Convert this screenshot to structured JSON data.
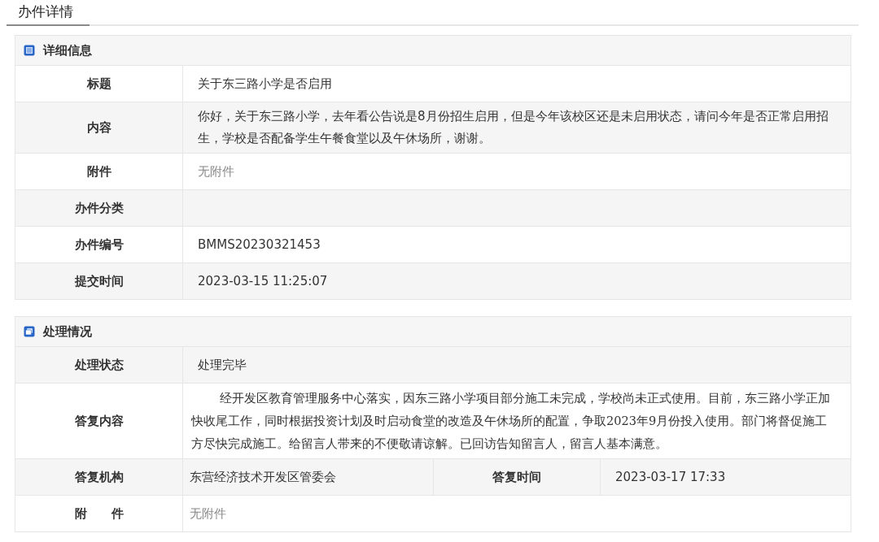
{
  "page_tab": {
    "label": "办件详情",
    "selected": true
  },
  "sections": [
    {
      "kind": "info",
      "title": "详细信息",
      "rows": [
        {
          "cells": [
            {
              "kind": "label",
              "text": "标题"
            },
            {
              "kind": "value",
              "text": "关于东三路小学是否启用"
            }
          ]
        },
        {
          "cells": [
            {
              "kind": "label",
              "text": "内容"
            },
            {
              "kind": "value",
              "text": "你好，关于东三路小学，去年看公告说是8月份招生启用，但是今年该校区还是未启用状态，请问今年是否正常启用招生，学校是否配备学生午餐食堂以及午休场所，谢谢。"
            }
          ]
        },
        {
          "cells": [
            {
              "kind": "label",
              "text": "附件"
            },
            {
              "kind": "muted",
              "text": "无附件"
            }
          ]
        },
        {
          "cells": [
            {
              "kind": "label",
              "text": "办件分类"
            },
            {
              "kind": "value"
            }
          ]
        },
        {
          "cells": [
            {
              "kind": "label",
              "text": "办件编号"
            },
            {
              "kind": "value",
              "text": "BMMS20230321453"
            }
          ]
        },
        {
          "cells": [
            {
              "kind": "label",
              "text": "提交时间"
            },
            {
              "kind": "value",
              "text": "2023-03-15 11:25:07"
            }
          ]
        }
      ]
    },
    {
      "kind": "process",
      "title": "处理情况",
      "rows": [
        {
          "cells": [
            {
              "kind": "label",
              "text": "处理状态"
            },
            {
              "kind": "value",
              "text": "处理完毕"
            }
          ]
        },
        {
          "cells": [
            {
              "kind": "label",
              "text": "答复内容"
            },
            {
              "kind": "reply",
              "text": "经开发区教育管理服务中心落实，因东三路小学项目部分施工未完成，学校尚未正式使用。目前，东三路小学正加快收尾工作，同时根据投资计划及时启动食堂的改造及午休场所的配置，争取2023年9月份投入使用。部门将督促施工方尽快完成施工。给留言人带来的不便敬请谅解。已回访告知留言人，留言人基本满意。"
            }
          ]
        },
        {
          "cells": [
            {
              "kind": "label",
              "text": "答复机构"
            },
            {
              "kind": "value2",
              "text": "东营经济技术开发区管委会"
            },
            {
              "kind": "label",
              "text": "答复时间"
            },
            {
              "kind": "value",
              "text": "2023-03-17 17:33"
            }
          ]
        },
        {
          "cells": [
            {
              "kind": "label",
              "text": "附　　件"
            },
            {
              "kind": "muted2",
              "text": "无附件"
            }
          ]
        }
      ]
    }
  ]
}
